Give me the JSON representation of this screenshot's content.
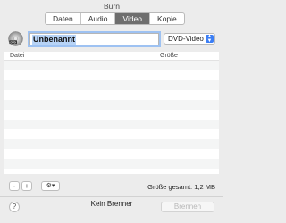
{
  "window": {
    "title": "Burn"
  },
  "tabs": [
    {
      "label": "Daten",
      "active": false
    },
    {
      "label": "Audio",
      "active": false
    },
    {
      "label": "Video",
      "active": true
    },
    {
      "label": "Kopie",
      "active": false
    }
  ],
  "project": {
    "disc_icon": "dvd-disc-icon",
    "name": "Unbenannt"
  },
  "format_select": {
    "selected": "DVD-Video",
    "icon": "chevron-updown-icon"
  },
  "table": {
    "columns": [
      "Datei",
      "Größe"
    ],
    "rows": []
  },
  "toolbar": {
    "remove_label": "-",
    "add_label": "+",
    "gear_icon": "gear-icon",
    "menu_arrow": "▾",
    "total_label": "Größe gesamt: 1,2 MB"
  },
  "footer": {
    "help_label": "?",
    "burner_status": "Kein Brenner",
    "burn_label": "Brennen"
  },
  "colors": {
    "accent": "#3b7ef5",
    "selection": "#b7d3f6",
    "focus_ring": "#9ec2f2",
    "active_tab": "#6e6e6e"
  }
}
